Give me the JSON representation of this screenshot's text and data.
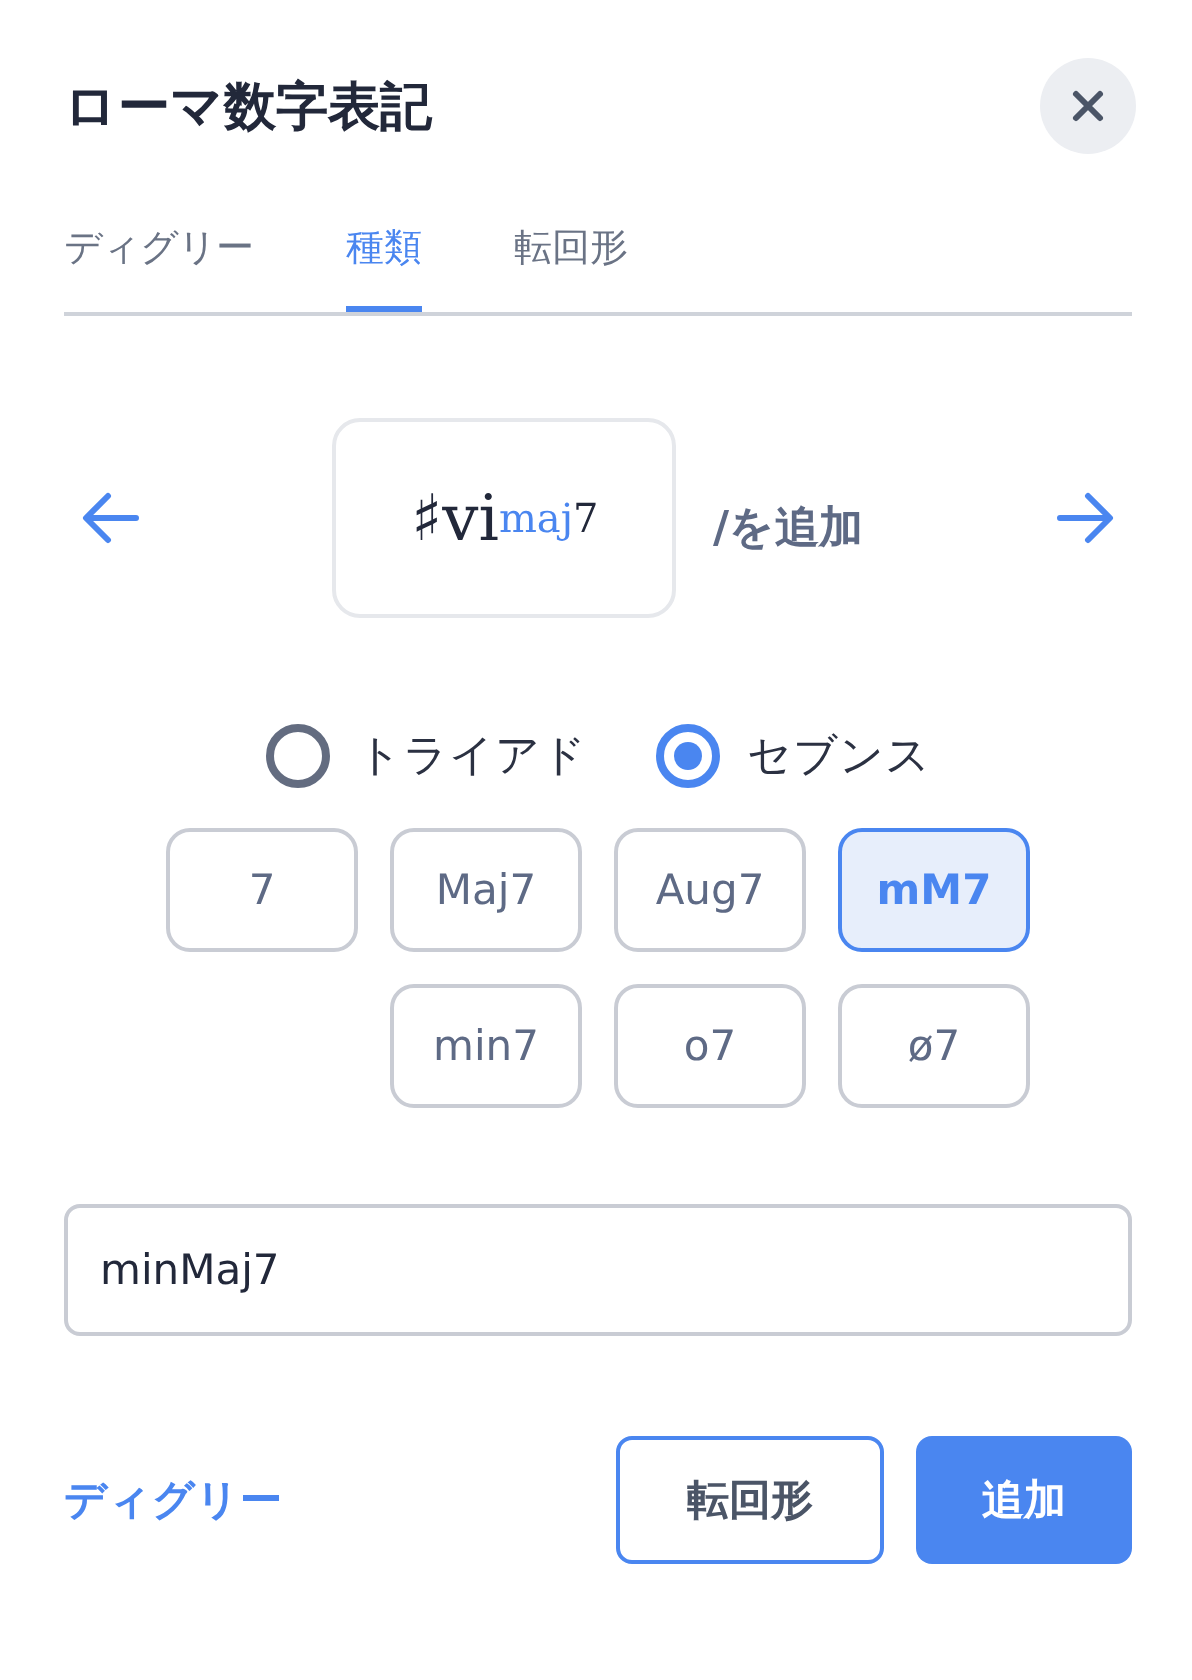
{
  "title": "ローマ数字表記",
  "tabs": [
    {
      "label": "ディグリー",
      "selected": false
    },
    {
      "label": "種類",
      "selected": true
    },
    {
      "label": "転回形",
      "selected": false
    }
  ],
  "preview": {
    "numeral": "♯vi",
    "quality": "maj",
    "extension": "7",
    "suffix": "/を追加"
  },
  "chord_type": [
    {
      "label": "トライアド",
      "selected": false
    },
    {
      "label": "セブンス",
      "selected": true
    }
  ],
  "qualities": [
    [
      {
        "label": "7",
        "selected": false
      },
      {
        "label": "Maj7",
        "selected": false
      },
      {
        "label": "Aug7",
        "selected": false
      },
      {
        "label": "mM7",
        "selected": true
      }
    ],
    [
      {
        "label": "min7",
        "selected": false
      },
      {
        "label": "o7",
        "selected": false
      },
      {
        "label": "ø7",
        "selected": false
      }
    ]
  ],
  "name_field": {
    "value": "minMaj7"
  },
  "footer": {
    "link": "ディグリー",
    "secondary": "転回形",
    "primary": "追加"
  }
}
